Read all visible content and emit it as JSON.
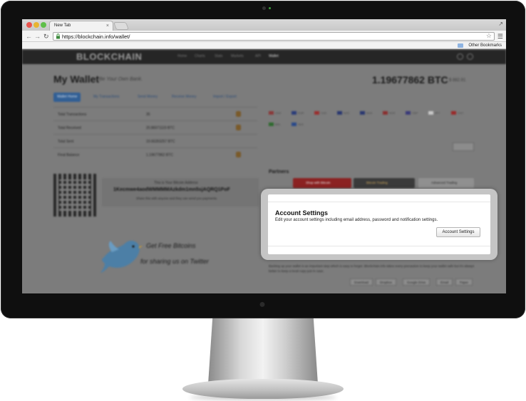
{
  "browser": {
    "tab_title": "New Tab",
    "tab_close": "×",
    "url": "https://blockchain.info/wallet/",
    "bookmark_folder": "Other Bookmarks"
  },
  "site": {
    "brand": "BLOCKCHAIN",
    "nav": [
      "Home",
      "Charts",
      "Stats",
      "Markets",
      "API",
      "Wallet"
    ],
    "wallet_title": "My Wallet",
    "wallet_subtitle": "Be Your Own Bank.",
    "balance": "1.19677862 BTC",
    "fiat": "$ 882.91",
    "tabs": [
      "Wallet Home",
      "My Transactions",
      "Send Money",
      "Receive Money",
      "Import / Export"
    ],
    "stats": [
      {
        "label": "Total Transactions",
        "value": "35"
      },
      {
        "label": "Total Received",
        "value": "20.86071119 BTC"
      },
      {
        "label": "Total Sent",
        "value": "19.66393257 BTC"
      },
      {
        "label": "Final Balance",
        "value": "1.19677862 BTC"
      }
    ],
    "currencies": [
      "USD",
      "EUR",
      "CAD",
      "NZD",
      "AUD",
      "NOK",
      "GBP",
      "JPY",
      "CNY",
      "BRL",
      "SEK"
    ],
    "address_caption": "This is Your Bitcoin Address",
    "address": "1Kecmwe4aodWMMMMAzkdm1mn5sjAQRQ1PoF",
    "address_note": "Share this with anyone and they can send you payments.",
    "partners_title": "Partners",
    "partners": [
      "Shop with Bitcoin",
      "Bitcoin Trading",
      "Advanced Trading"
    ],
    "tweet_line1": "Get Free Bitcoins",
    "tweet_line2": "for sharing us on Twitter",
    "backup_text": "Backing up your wallet is an important step which is easy to forget. Blockchain.info takes every precaution to keep your wallet safe but it's always better to keep a local copy just in case.",
    "backup_buttons": [
      "Download",
      "Dropbox",
      "Google Drive",
      "Email",
      "Paper"
    ]
  },
  "modal": {
    "title": "Account Settings",
    "description": "Edit your account settings including email address, password and notification settings.",
    "button": "Account Settings"
  },
  "colors": {
    "bezel": "#0f0f0f",
    "overlay": "#7c7c7c",
    "site_nav": "#262626",
    "tab_active": "#315f95"
  }
}
